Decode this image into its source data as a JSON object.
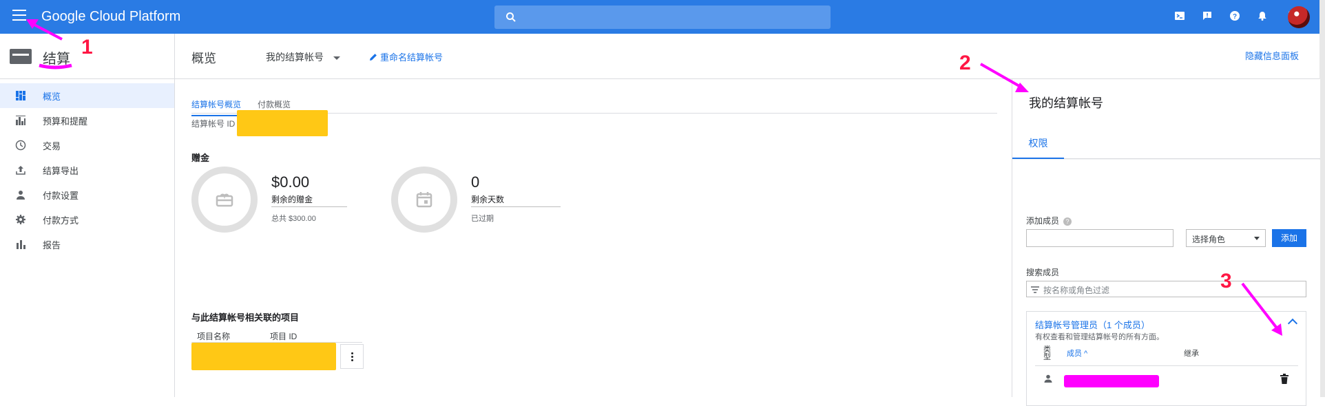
{
  "header": {
    "brand": "Google Cloud Platform",
    "icons": [
      "menu-icon",
      "search-icon",
      "terminal-icon",
      "feedback-icon",
      "help-icon",
      "notification-icon",
      "more-vert-icon",
      "avatar"
    ]
  },
  "sidebar": {
    "title": "结算",
    "items": [
      {
        "label": "概览",
        "icon": "dashboard-icon",
        "active": true
      },
      {
        "label": "预算和提醒",
        "icon": "budget-icon"
      },
      {
        "label": "交易",
        "icon": "clock-icon"
      },
      {
        "label": "结算导出",
        "icon": "upload-icon"
      },
      {
        "label": "付款设置",
        "icon": "person-icon"
      },
      {
        "label": "付款方式",
        "icon": "gear-icon"
      },
      {
        "label": "报告",
        "icon": "bar-chart-icon"
      }
    ]
  },
  "main": {
    "page_title": "概览",
    "account_selector": "我的结算帐号",
    "rename_link": "重命名结算帐号",
    "hide_panel_link": "隐藏信息面板",
    "tabs": [
      "结算帐号概览",
      "付款概览"
    ],
    "account_id_label": "结算帐号 ID",
    "credits": {
      "title": "赠金",
      "remaining_value": "$0.00",
      "remaining_label": "剩余的赠金",
      "remaining_total": "总共 $300.00",
      "days_value": "0",
      "days_label": "剩余天数",
      "days_status": "已过期"
    },
    "projects": {
      "title": "与此结算帐号相关联的项目",
      "columns": [
        "项目名称",
        "项目 ID"
      ]
    }
  },
  "panel": {
    "title": "我的结算帐号",
    "tab": "权限",
    "add_member_label": "添加成员",
    "role_select_placeholder": "选择角色",
    "add_button": "添加",
    "search_member_label": "搜索成员",
    "filter_placeholder": "按名称或角色过滤",
    "role_group": {
      "title": "结算帐号管理员（1 个成员）",
      "description": "有权查看和管理结算帐号的所有方面。",
      "col_type": "类型",
      "col_member": "成员 ^",
      "col_inherit": "继承"
    }
  },
  "annotations": {
    "n1": "1",
    "n2": "2",
    "n3": "3",
    "color": "#ff00ff"
  }
}
